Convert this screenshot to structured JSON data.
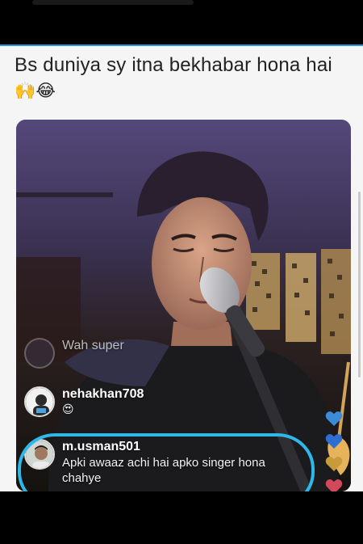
{
  "post": {
    "caption": "Bs duniya sy itna bekhabar hona hai",
    "caption_emoji": "🙌😂"
  },
  "live": {
    "comments": [
      {
        "username": "",
        "text": "Wah super",
        "faded": true
      },
      {
        "username": "nehakhan708",
        "text": "😍"
      },
      {
        "username": "m.usman501",
        "text": "Apki awaaz achi hai apko singer hona chahye",
        "highlighted": true
      }
    ],
    "heart_colors": [
      "#3b8bd9",
      "#2d6ed0",
      "#c79b3a",
      "#d24a5a"
    ]
  },
  "footer": {
    "reaction_emoji": "😂😂"
  },
  "colors": {
    "accent": "#2fb7ea",
    "post_border": "#1d9bd6"
  }
}
